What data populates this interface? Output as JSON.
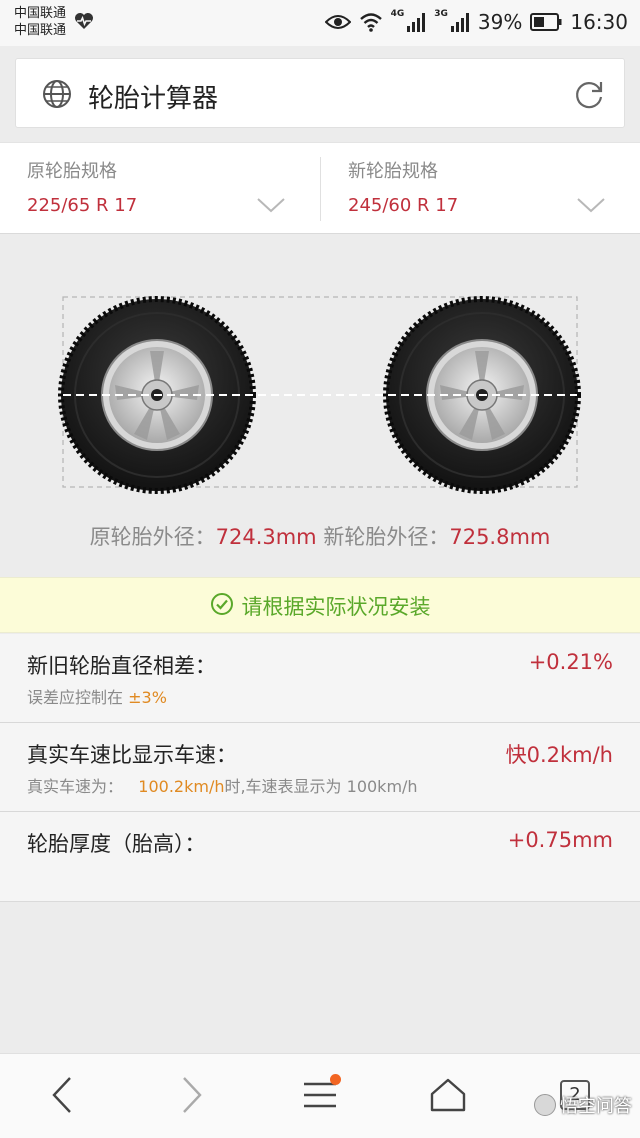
{
  "status_bar": {
    "carrier_1": "中国联通",
    "carrier_2": "中国联通",
    "network_1": "4G",
    "network_2": "3G",
    "battery": "39%",
    "time": "16:30"
  },
  "url_bar": {
    "title": "轮胎计算器",
    "icon": "globe-icon",
    "refresh_icon": "refresh-icon"
  },
  "specs": {
    "original": {
      "label": "原轮胎规格",
      "value": "225/65 R 17"
    },
    "new": {
      "label": "新轮胎规格",
      "value": "245/60 R 17"
    }
  },
  "diameters": {
    "original_label": "原轮胎外径：",
    "original_value": "724.3mm",
    "new_label": "新轮胎外径：",
    "new_value": "725.8mm"
  },
  "notice": {
    "text": "请根据实际状况安装",
    "icon": "check-circle-icon"
  },
  "results": [
    {
      "title": "新旧轮胎直径相差：",
      "value": "+0.21%",
      "sub_prefix": "误差应控制在",
      "sub_highlight": "±3%",
      "sub_suffix": ""
    },
    {
      "title": "真实车速比显示车速：",
      "value": "快0.2km/h",
      "sub_prefix": "真实车速为：",
      "sub_highlight": "100.2km/h",
      "sub_suffix": "时,车速表显示为 100km/h"
    },
    {
      "title": "轮胎厚度（胎高）：",
      "value": "+0.75mm"
    }
  ],
  "bottom_nav": {
    "tab_count": "2",
    "watermark": "悟空问答"
  },
  "colors": {
    "accent_red": "#c0303c",
    "highlight_orange": "#e08a22",
    "success_green": "#5aa82a",
    "notice_bg": "#fcfcd8",
    "notification_dot": "#f26522"
  }
}
